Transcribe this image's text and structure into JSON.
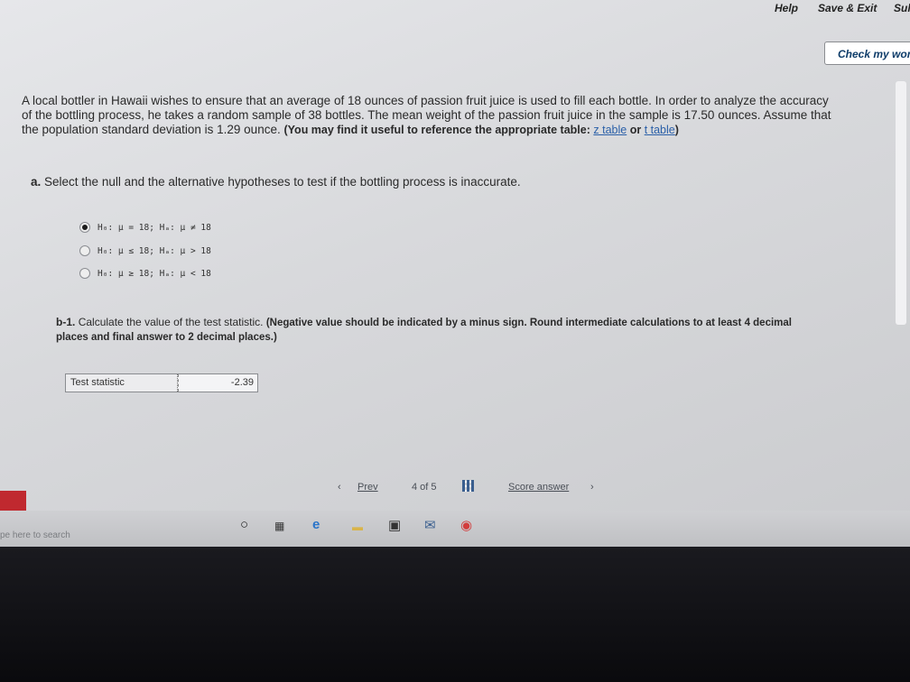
{
  "header": {
    "help": "Help",
    "save_exit": "Save & Exit",
    "submit": "Sul"
  },
  "check_button": "Check my worl",
  "question": {
    "text": "A local bottler in Hawaii wishes to ensure that an average of 18 ounces of passion fruit juice is used to fill each bottle. In order to analyze the accuracy of the bottling process, he takes a random sample of 38 bottles. The mean weight of the passion fruit juice in the sample is 17.50 ounces. Assume that the population standard deviation is 1.29 ounce.",
    "note_prefix": "(You may find it useful to reference the appropriate table:",
    "z_link": "z table",
    "or": "or",
    "t_link": "t table",
    "note_suffix": ")"
  },
  "part_a": {
    "label": "a.",
    "text": "Select the null and the alternative hypotheses to test if the bottling process is inaccurate.",
    "options": [
      {
        "text": "H₀: μ = 18;  Hₐ: μ ≠ 18",
        "selected": true
      },
      {
        "text": "H₀: μ ≤ 18;  Hₐ: μ > 18",
        "selected": false
      },
      {
        "text": "H₀: μ ≥ 18;  Hₐ: μ < 18",
        "selected": false
      }
    ]
  },
  "part_b1": {
    "label": "b-1.",
    "text": "Calculate the value of the test statistic.",
    "note": "(Negative value should be indicated by a minus sign. Round intermediate calculations to at least 4 decimal places and final answer to 2 decimal places.)",
    "field_label": "Test statistic",
    "field_value": "-2.39"
  },
  "nav": {
    "prev": "Prev",
    "page": "4 of 5",
    "score": "Score answer"
  },
  "taskbar": {
    "search_placeholder": "pe here to search"
  }
}
